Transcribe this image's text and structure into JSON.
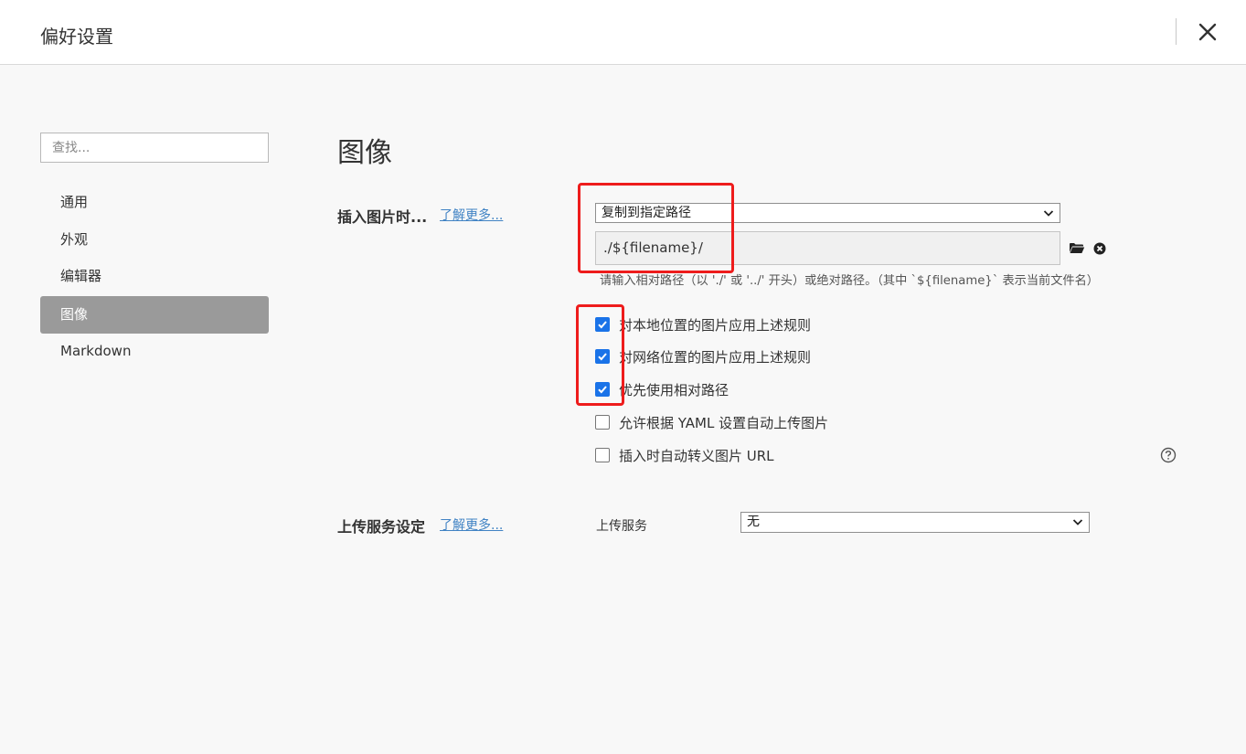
{
  "window": {
    "title": "偏好设置",
    "close_icon": "close-icon"
  },
  "sidebar": {
    "search_placeholder": "查找...",
    "items": [
      {
        "label": "通用",
        "active": false
      },
      {
        "label": "外观",
        "active": false
      },
      {
        "label": "编辑器",
        "active": false
      },
      {
        "label": "图像",
        "active": true
      },
      {
        "label": "Markdown",
        "active": false
      }
    ]
  },
  "main": {
    "section_title": "图像",
    "insert_image": {
      "label": "插入图片时...",
      "learn_more": "了解更多...",
      "action_select": "复制到指定路径",
      "path_value": "./${filename}/",
      "folder_icon": "folder-icon",
      "clear_icon": "clear-icon",
      "hint": "请输入相对路径（以 './' 或 '../' 开头）或绝对路径。（其中 `${filename}` 表示当前文件名）",
      "options": [
        {
          "label": "对本地位置的图片应用上述规则",
          "checked": true
        },
        {
          "label": "对网络位置的图片应用上述规则",
          "checked": true
        },
        {
          "label": "优先使用相对路径",
          "checked": true
        },
        {
          "label": "允许根据 YAML 设置自动上传图片",
          "checked": false
        },
        {
          "label": "插入时自动转义图片 URL",
          "checked": false
        }
      ],
      "help_icon": "help-icon"
    },
    "upload": {
      "label": "上传服务设定",
      "learn_more": "了解更多...",
      "service_label": "上传服务",
      "service_value": "无"
    }
  },
  "colors": {
    "annotation": "#ee1c1c",
    "checkbox": "#1a73e8",
    "link": "#4183c4",
    "active_nav": "#9a9a9a"
  }
}
